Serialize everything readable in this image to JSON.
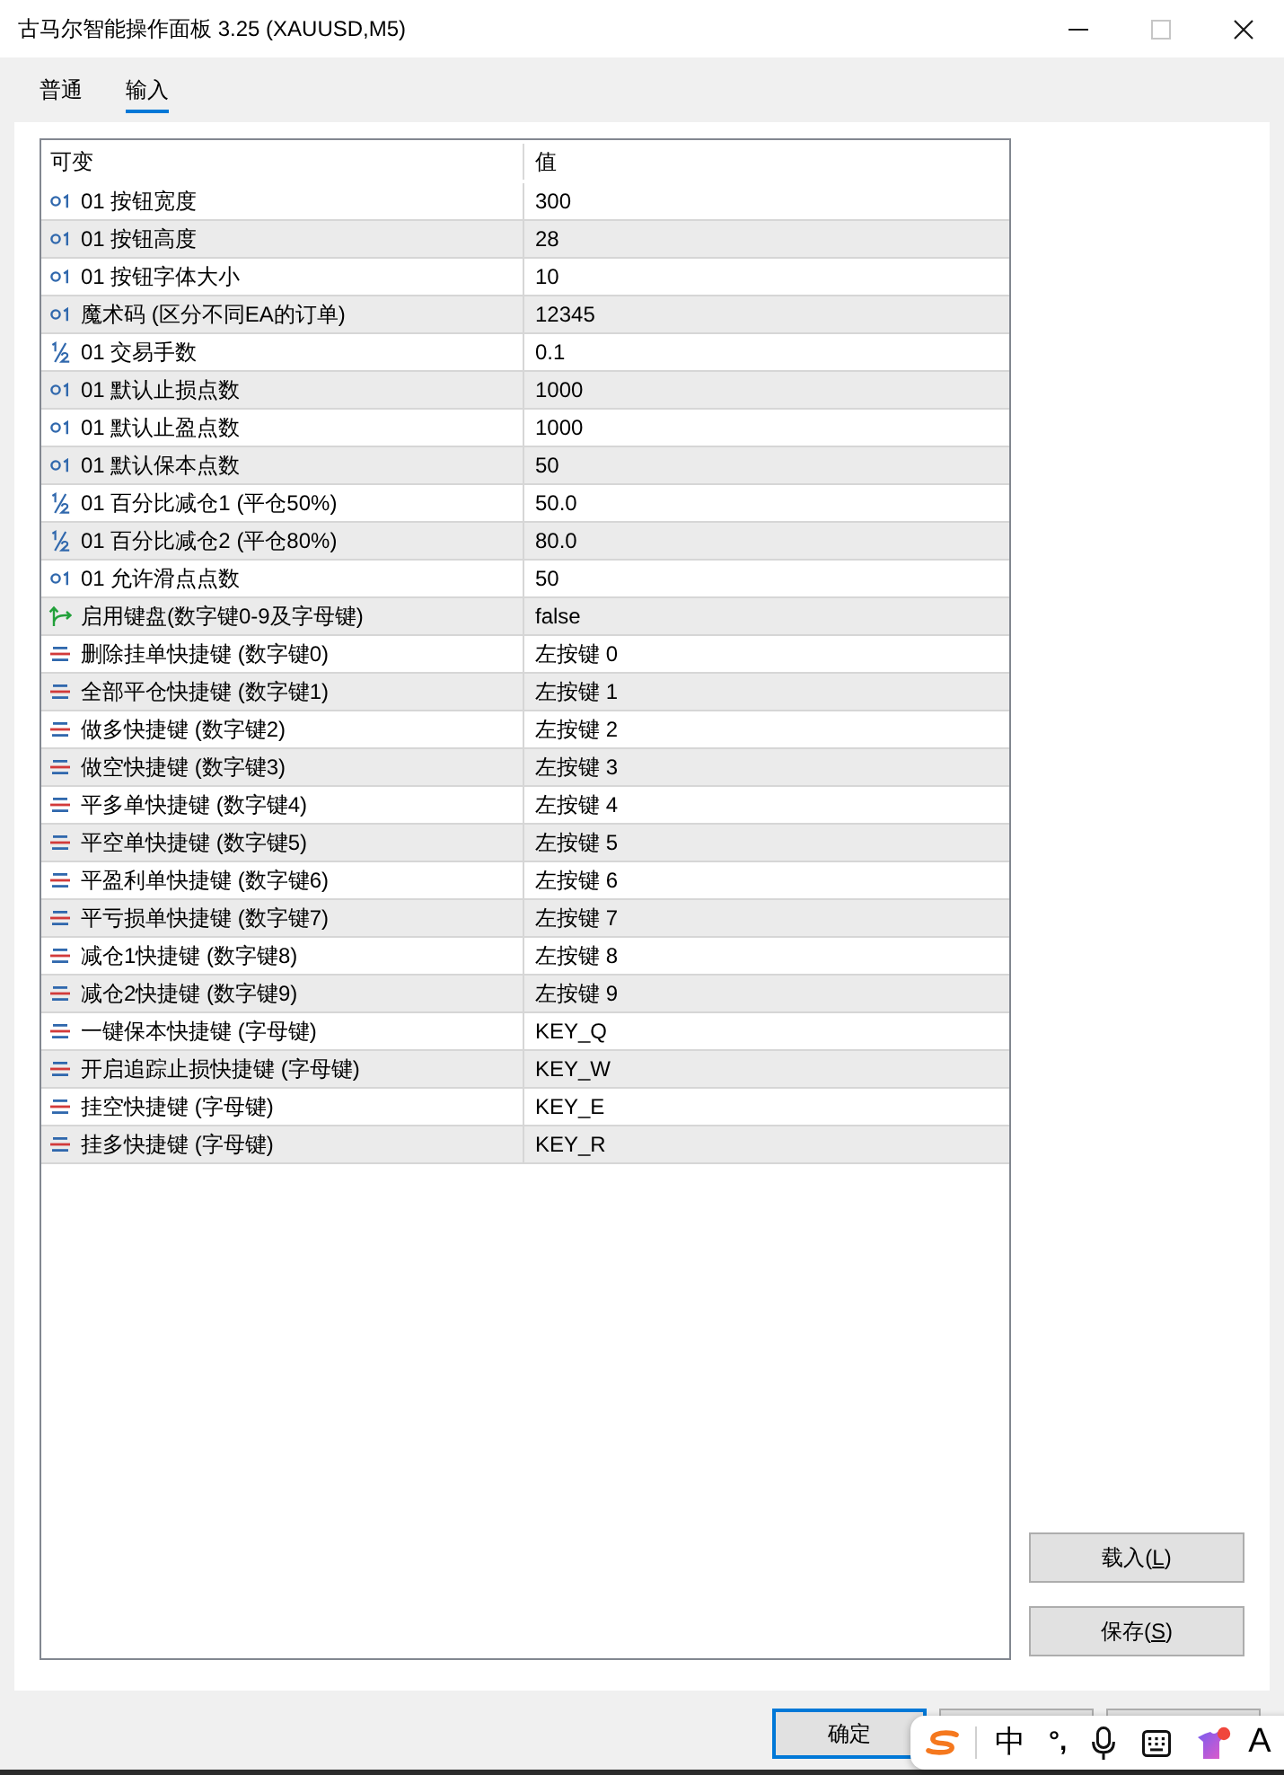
{
  "window": {
    "title": "古马尔智能操作面板 3.25 (XAUUSD,M5)",
    "controls": [
      {
        "kind": "minimize",
        "disabled": false
      },
      {
        "kind": "maximize",
        "disabled": true
      },
      {
        "kind": "close",
        "disabled": false
      }
    ]
  },
  "tabs": [
    {
      "label": "普通",
      "selected": false
    },
    {
      "label": "输入",
      "selected": true
    }
  ],
  "table": {
    "columns": [
      "可变",
      "值"
    ],
    "rows": [
      {
        "kind": "int",
        "name": "01 按钮宽度",
        "value": "300"
      },
      {
        "kind": "int",
        "name": "01 按钮高度",
        "value": "28"
      },
      {
        "kind": "int",
        "name": "01 按钮字体大小",
        "value": "10"
      },
      {
        "kind": "int",
        "name": "魔术码 (区分不同EA的订单)",
        "value": "12345"
      },
      {
        "kind": "double",
        "name": "01 交易手数",
        "value": "0.1"
      },
      {
        "kind": "int",
        "name": "01 默认止损点数",
        "value": "1000"
      },
      {
        "kind": "int",
        "name": "01 默认止盈点数",
        "value": "1000"
      },
      {
        "kind": "int",
        "name": "01 默认保本点数",
        "value": "50"
      },
      {
        "kind": "double",
        "name": "01 百分比减仓1 (平仓50%)",
        "value": "50.0"
      },
      {
        "kind": "double",
        "name": "01 百分比减仓2 (平仓80%)",
        "value": "80.0"
      },
      {
        "kind": "int",
        "name": "01 允许滑点点数",
        "value": "50"
      },
      {
        "kind": "bool",
        "name": "启用键盘(数字键0-9及字母键)",
        "value": "false"
      },
      {
        "kind": "enum",
        "name": "删除挂单快捷键 (数字键0)",
        "value": "左按键 0"
      },
      {
        "kind": "enum",
        "name": "全部平仓快捷键 (数字键1)",
        "value": "左按键 1"
      },
      {
        "kind": "enum",
        "name": "做多快捷键 (数字键2)",
        "value": "左按键 2"
      },
      {
        "kind": "enum",
        "name": "做空快捷键 (数字键3)",
        "value": "左按键 3"
      },
      {
        "kind": "enum",
        "name": "平多单快捷键 (数字键4)",
        "value": "左按键 4"
      },
      {
        "kind": "enum",
        "name": "平空单快捷键 (数字键5)",
        "value": "左按键 5"
      },
      {
        "kind": "enum",
        "name": "平盈利单快捷键 (数字键6)",
        "value": "左按键 6"
      },
      {
        "kind": "enum",
        "name": "平亏损单快捷键 (数字键7)",
        "value": "左按键 7"
      },
      {
        "kind": "enum",
        "name": "减仓1快捷键 (数字键8)",
        "value": "左按键 8"
      },
      {
        "kind": "enum",
        "name": "减仓2快捷键 (数字键9)",
        "value": "左按键 9"
      },
      {
        "kind": "enum",
        "name": "一键保本快捷键 (字母键)",
        "value": "KEY_Q"
      },
      {
        "kind": "enum",
        "name": "开启追踪止损快捷键 (字母键)",
        "value": "KEY_W"
      },
      {
        "kind": "enum",
        "name": "挂空快捷键 (字母键)",
        "value": "KEY_E"
      },
      {
        "kind": "enum",
        "name": "挂多快捷键 (字母键)",
        "value": "KEY_R"
      }
    ]
  },
  "side_buttons": [
    {
      "label_before": "载入(",
      "access_key": "L",
      "label_after": ")"
    },
    {
      "label_before": "保存(",
      "access_key": "S",
      "label_after": ")"
    }
  ],
  "footer_buttons": [
    {
      "label": "确定",
      "default": true
    },
    {
      "default": false
    },
    {
      "default": false
    }
  ],
  "ime_toolbar": {
    "items": [
      {
        "kind": "logo"
      },
      {
        "kind": "mode",
        "text": "中"
      },
      {
        "kind": "punctuation",
        "text": "°,"
      },
      {
        "kind": "mic"
      },
      {
        "kind": "keyboard"
      },
      {
        "kind": "skin"
      },
      {
        "kind": "font",
        "text": "A"
      }
    ]
  }
}
